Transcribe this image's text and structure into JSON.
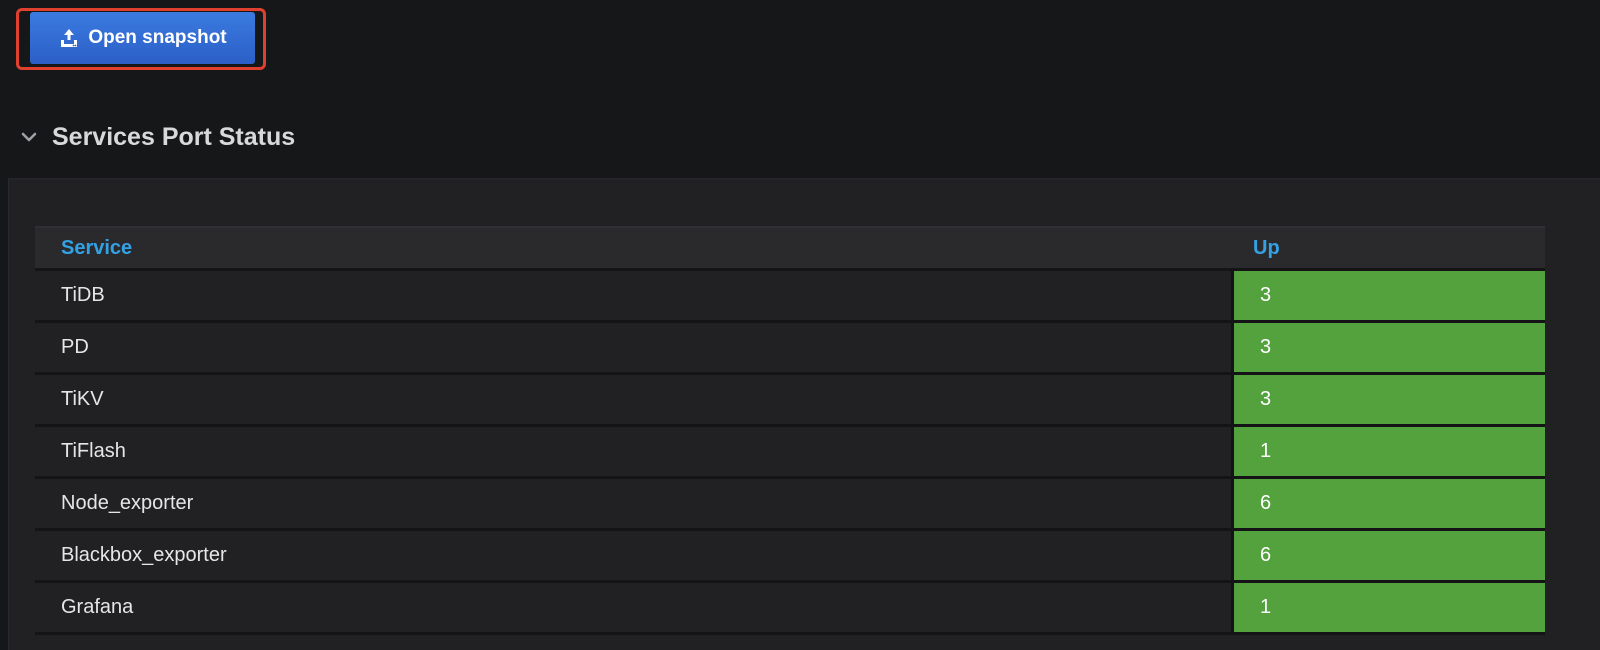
{
  "toolbar": {
    "open_snapshot_label": "Open snapshot",
    "open_snapshot_icon": "upload-icon"
  },
  "row": {
    "title": "Services Port Status",
    "icon": "chevron-down-icon"
  },
  "table": {
    "headers": {
      "service": "Service",
      "up": "Up"
    },
    "rows": [
      {
        "service": "TiDB",
        "up": "3"
      },
      {
        "service": "PD",
        "up": "3"
      },
      {
        "service": "TiKV",
        "up": "3"
      },
      {
        "service": "TiFlash",
        "up": "1"
      },
      {
        "service": "Node_exporter",
        "up": "6"
      },
      {
        "service": "Blackbox_exporter",
        "up": "6"
      },
      {
        "service": "Grafana",
        "up": "1"
      }
    ]
  },
  "colors": {
    "background": "#161719",
    "panel": "#212124",
    "header_text": "#33a2e5",
    "status_ok": "#53a23e",
    "button": "#2b5fc7",
    "highlight_outline": "#e0412e"
  }
}
